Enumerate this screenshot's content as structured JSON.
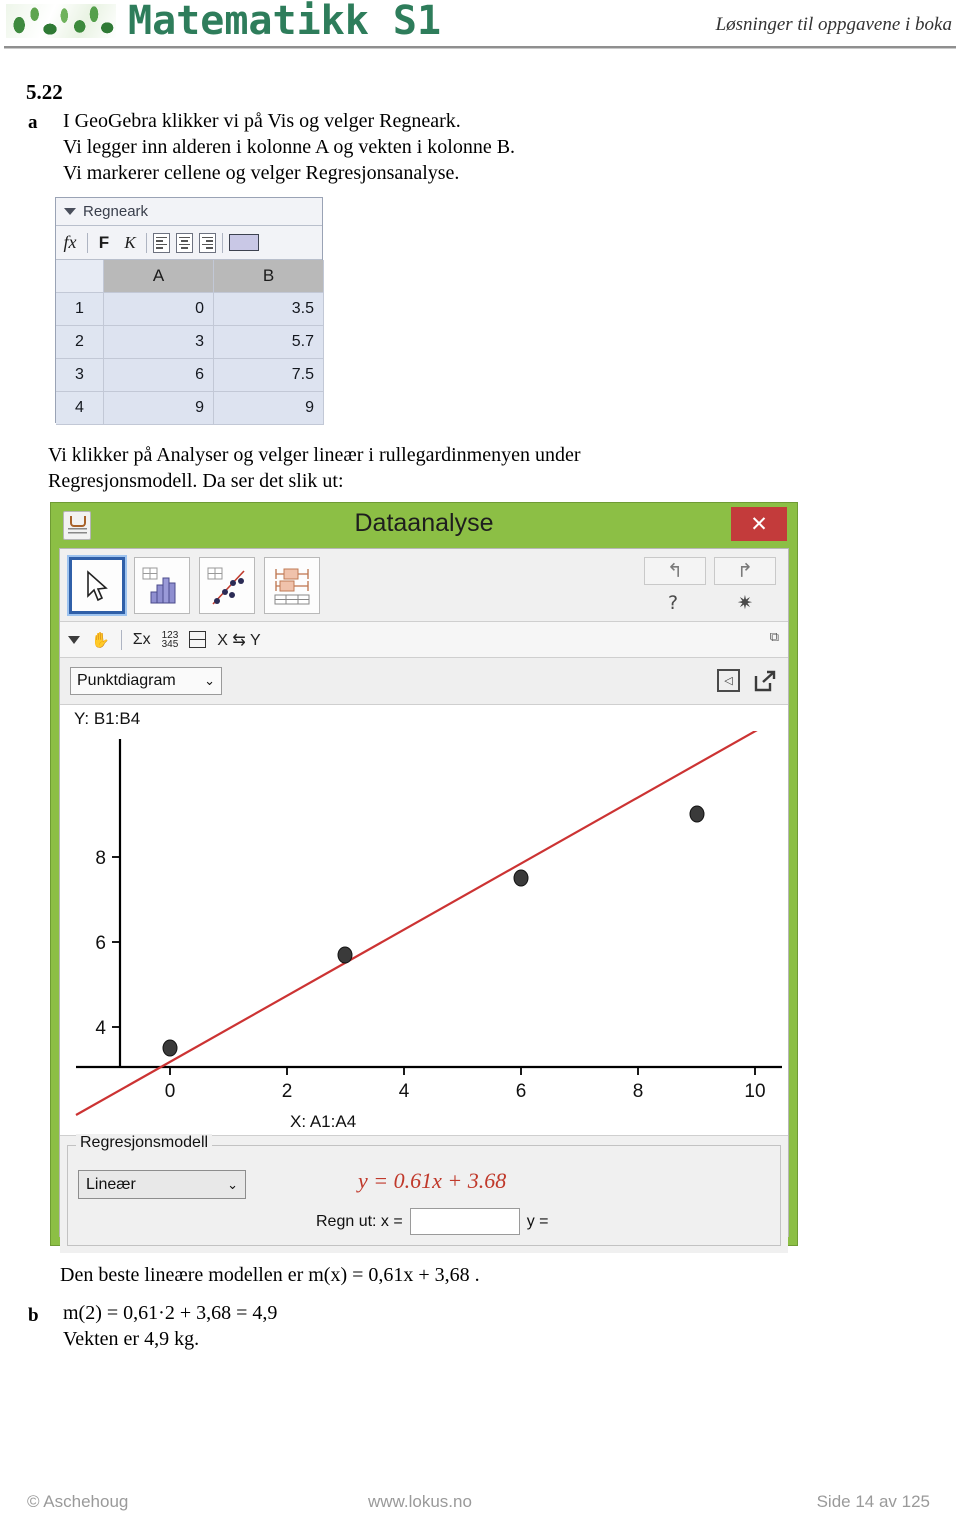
{
  "header": {
    "brand": "Matematikk S1",
    "subtitle": "Løsninger til oppgavene i boka",
    "logo_icon": "leaf-pattern-logo"
  },
  "task": {
    "number": "5.22",
    "item_a_letter": "a",
    "item_b_letter": "b",
    "paragraph_a": [
      "I GeoGebra klikker vi på Vis og velger Regneark.",
      "Vi legger inn alderen i kolonne A og vekten i kolonne B.",
      "Vi markerer cellene og velger Regresjonsanalyse."
    ],
    "paragraph_mid": [
      "Vi klikker på Analyser og velger lineær i rullegardinmenyen under",
      "Regresjonsmodell. Da ser det slik ut:"
    ],
    "conclusion": "Den beste lineære modellen er  m(x) = 0,61x + 3,68 .",
    "item_b_lines": [
      "m(2) = 0,61·2 + 3,68 = 4,9",
      "Vekten er 4,9 kg."
    ]
  },
  "spreadsheet": {
    "title": "Regneark",
    "toolbar": {
      "fx": "fx",
      "bold": "F",
      "italic": "K",
      "align_left_icon": "align-left-icon",
      "align_center_icon": "align-center-icon",
      "align_right_icon": "align-right-icon",
      "color_swatch_icon": "color-swatch-icon",
      "color_hex": "#c9c8e6"
    },
    "columns": [
      "A",
      "B"
    ],
    "rows": [
      {
        "label": "1",
        "a": "0",
        "b": "3.5"
      },
      {
        "label": "2",
        "a": "3",
        "b": "5.7"
      },
      {
        "label": "3",
        "a": "6",
        "b": "7.5"
      },
      {
        "label": "4",
        "a": "9",
        "b": "9"
      }
    ]
  },
  "dialog": {
    "title": "Dataanalyse",
    "close_label": "✕",
    "app_icon": "java-coffee-cup-icon",
    "titlebar_color": "#8cbf45",
    "close_color": "#c33b3b",
    "tools": [
      {
        "name": "pointer-tool",
        "selected": true
      },
      {
        "name": "histogram-tool",
        "selected": false
      },
      {
        "name": "scatter-regression-tool",
        "selected": false
      },
      {
        "name": "boxplot-tool",
        "selected": false
      }
    ],
    "undo_icon": "↰",
    "redo_icon": "↱",
    "help_icon": "?",
    "gear_icon": "✷",
    "toolbar2": {
      "dropdown_icon": "triangle-down-icon",
      "hand_icon": "✋",
      "sigma_label": "Σx",
      "numbers_top": "123",
      "numbers_bottom": "345",
      "two_rows_icon": "two-rows-icon",
      "swap_label": "X ⇆ Y",
      "expand_icon": "⧉"
    },
    "plot_type": "Punktdiagram",
    "chevron": "⌄",
    "panel_left_icon": "◁",
    "panel_pop_icon": "↗",
    "y_range_label": "Y:  B1:B4",
    "x_range_label": "X:  A1:A4",
    "regression": {
      "legend": "Regresjonsmodell",
      "model": "Lineær",
      "equation": "y = 0.61x + 3.68",
      "calc_label": "Regn ut:  x =",
      "calc_value": "",
      "result_label": "y ="
    }
  },
  "chart_data": {
    "type": "scatter",
    "title": "",
    "xlabel": "X:  A1:A4",
    "ylabel": "Y:  B1:B4",
    "x": [
      0,
      3,
      6,
      9
    ],
    "y": [
      3.5,
      5.7,
      7.5,
      9
    ],
    "point_color": "#3a3a3a",
    "xticks": [
      0,
      2,
      4,
      6,
      8,
      10
    ],
    "yticks": [
      4,
      6,
      8
    ],
    "xlim": [
      -1.1,
      11.2
    ],
    "ylim": [
      2.8,
      10.4
    ],
    "grid": false,
    "legend": "none",
    "series": [
      {
        "name": "regression-line",
        "type": "line",
        "equation": "y = 0.61x + 3.68",
        "slope": 0.61,
        "intercept": 3.68,
        "color": "#cc3333"
      }
    ]
  },
  "footer": {
    "copyright": "© Aschehoug",
    "site": "www.lokus.no",
    "page": "Side 14 av 125"
  }
}
